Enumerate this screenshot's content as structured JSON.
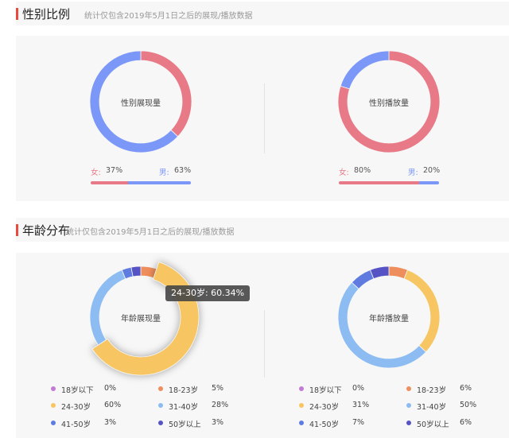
{
  "gender_section": {
    "title": "性别比例",
    "subtitle": "统计仅包含2019年5月1日之后的展现/播放数据"
  },
  "age_section": {
    "title": "年龄分布",
    "subtitle": "统计仅包含2019年5月1日之后的展现/播放数据"
  },
  "colors": {
    "female": "#e87a87",
    "male": "#7b97f7",
    "accent": "#e84a3d",
    "age": [
      "#c17ad6",
      "#ee8e5c",
      "#f7c662",
      "#8cbcf2",
      "#5f7be0",
      "#5654c4"
    ]
  },
  "tooltip": {
    "text": "24-30岁: 60.34%"
  },
  "chart_data": [
    {
      "type": "pie",
      "title": "性别展现量",
      "slices": [
        {
          "label": "女",
          "value": 37,
          "display": "37%"
        },
        {
          "label": "男",
          "value": 63,
          "display": "63%"
        }
      ],
      "female_label": "女:",
      "male_label": "男:"
    },
    {
      "type": "pie",
      "title": "性别播放量",
      "slices": [
        {
          "label": "女",
          "value": 80,
          "display": "80%"
        },
        {
          "label": "男",
          "value": 20,
          "display": "20%"
        }
      ],
      "female_label": "女:",
      "male_label": "男:"
    },
    {
      "type": "pie",
      "title": "年龄展现量",
      "highlighted": "24-30岁",
      "slices": [
        {
          "label": "18岁以下",
          "value": 0,
          "display": "0%"
        },
        {
          "label": "18-23岁",
          "value": 5,
          "display": "5%"
        },
        {
          "label": "24-30岁",
          "value": 60.34,
          "display": "60%"
        },
        {
          "label": "31-40岁",
          "value": 28,
          "display": "28%"
        },
        {
          "label": "41-50岁",
          "value": 3,
          "display": "3%"
        },
        {
          "label": "50岁以上",
          "value": 3,
          "display": "3%"
        }
      ]
    },
    {
      "type": "pie",
      "title": "年龄播放量",
      "slices": [
        {
          "label": "18岁以下",
          "value": 0,
          "display": "0%"
        },
        {
          "label": "18-23岁",
          "value": 6,
          "display": "6%"
        },
        {
          "label": "24-30岁",
          "value": 31,
          "display": "31%"
        },
        {
          "label": "31-40岁",
          "value": 50,
          "display": "50%"
        },
        {
          "label": "41-50岁",
          "value": 7,
          "display": "7%"
        },
        {
          "label": "50岁以上",
          "value": 6,
          "display": "6%"
        }
      ]
    }
  ]
}
